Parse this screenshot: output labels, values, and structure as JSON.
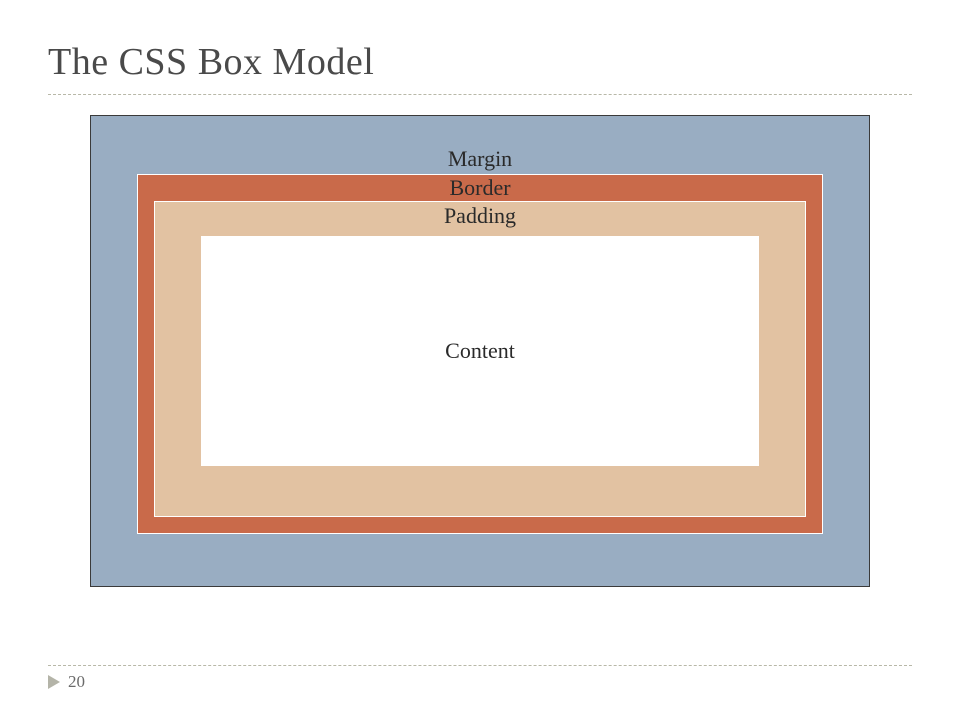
{
  "title": "The CSS Box Model",
  "diagram": {
    "margin_label": "Margin",
    "border_label": "Border",
    "padding_label": "Padding",
    "content_label": "Content"
  },
  "page_number": "20",
  "colors": {
    "margin_bg": "#99adc2",
    "border_bg": "#c96a4a",
    "padding_bg": "#e2c2a2",
    "content_bg": "#ffffff"
  }
}
